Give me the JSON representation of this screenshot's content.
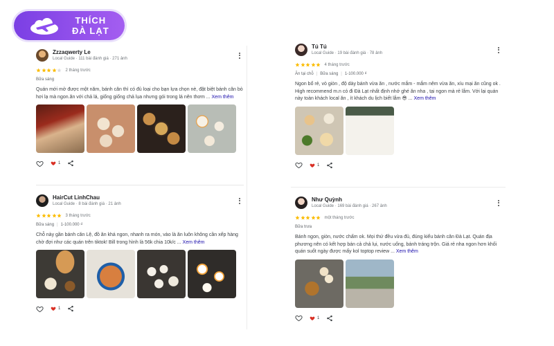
{
  "logo": {
    "text_line1": "THÍCH",
    "text_line2": "ĐÀ LẠT"
  },
  "reviews": [
    {
      "name": "Zzzaqwerty Le",
      "meta": "Local Guide · 111 bài đánh giá · 271 ảnh",
      "rating": 4,
      "when": "2 tháng trước",
      "meal": "Bữa sáng",
      "price": "",
      "text": "Quán mới mở được một năm, bánh căn thì có đủ loại cho bạn lựa chọn nè, đặt biệt bánh căn bò hơi lạ mà ngon.ăn với chả lá, giống giống chả lụa nhưng gói trong lá nên thơm ...",
      "more": "Xem thêm",
      "likes": "1",
      "photos": [
        "grilled-food-photo",
        "banh-can-plate-photo",
        "banh-can-fried-photo",
        "banh-can-quail-egg-photo"
      ]
    },
    {
      "name": "HairCut LinhChau",
      "meta": "Local Guide · 8 bài đánh giá · 21 ảnh",
      "rating": 5,
      "when": "3 tháng trước",
      "meal": "Bữa sáng",
      "price": "1-100.000 ₫",
      "text": "Chỗ này gần bánh căn Lệ, đồ ăn khá ngon, nhanh ra món, vào là ăn luôn không cần xếp hàng chờ đợi như các quán trên tiktok! Bill trong hình là 56k chia 10k/c ...",
      "more": "Xem thêm",
      "likes": "1",
      "photos": [
        "bread-dipping-bowl-photo",
        "meatball-soup-photo",
        "banh-can-tray-photo",
        "banh-can-eggs-photo"
      ]
    },
    {
      "name": "Tú Tú",
      "meta": "Local Guide · 19 bài đánh giá · 78 ảnh",
      "rating": 5,
      "when": "4 tháng trước",
      "meal": "Bữa sáng",
      "dine": "Ăn tại chỗ",
      "price": "1-100.000 ₫",
      "text": "Ngon bổ rẻ, vỏ giòn , độ dày bánh vừa ăn , nước mắm - mắm nêm vừa ăn, xíu mại ăn cũng ok . High recommend m.n có đi Đà Lạt nhất định nhớ ghé ăn nha , tại ngon mà rẻ lắm. Với lại quán này toàn khách local ăn , ít khách du lịch biết lắm 😎 ...",
      "more": "Xem thêm",
      "likes": "1",
      "photos": [
        "banh-can-table-photo",
        "menu-board-photo"
      ]
    },
    {
      "name": "Như Quỳnh",
      "meta": "Local Guide · 169 bài đánh giá · 267 ảnh",
      "rating": 5,
      "when": "một tháng trước",
      "meal": "Bữa trưa",
      "price": "",
      "text": "Bánh ngon, giòn, nước chấm ok. Mọi thứ đều vừa đủ, đúng kiểu bánh căn Đà Lạt. Quán địa phương nên có kết hợp bán cả chả lụi, nước uống, bánh tráng trộn. Giá rẻ nha ngon hơn khối quán suốt ngày được mấy kol toptop review ...",
      "more": "Xem thêm",
      "likes": "1",
      "photos": [
        "banh-can-dipping-photo",
        "shop-front-photo"
      ]
    }
  ],
  "colors": {
    "star": "#fbbc04",
    "star_empty": "#dadce0",
    "heart": "#d93025",
    "link": "#1a0dab",
    "brand": "#7b3fe4"
  }
}
